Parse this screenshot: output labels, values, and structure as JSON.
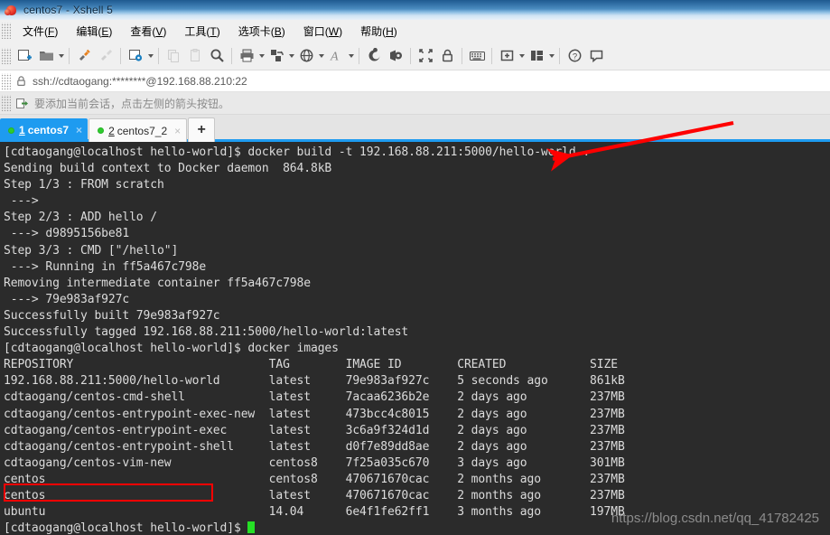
{
  "window": {
    "title": "centos7 - Xshell 5",
    "logo_icon": "xshell-logo-icon"
  },
  "menubar": {
    "items": [
      {
        "name": "file",
        "pre": "文件(",
        "key": "F",
        "post": ")"
      },
      {
        "name": "edit",
        "pre": "编辑(",
        "key": "E",
        "post": ")"
      },
      {
        "name": "view",
        "pre": "查看(",
        "key": "V",
        "post": ")"
      },
      {
        "name": "tools",
        "pre": "工具(",
        "key": "T",
        "post": ")"
      },
      {
        "name": "tabs",
        "pre": "选项卡(",
        "key": "B",
        "post": ")"
      },
      {
        "name": "window",
        "pre": "窗口(",
        "key": "W",
        "post": ")"
      },
      {
        "name": "help",
        "pre": "帮助(",
        "key": "H",
        "post": ")"
      }
    ]
  },
  "toolbar": {
    "buttons": [
      {
        "name": "new-session-icon",
        "enabled": true,
        "caret": false
      },
      {
        "name": "open-folder-icon",
        "enabled": true,
        "caret": true
      },
      {
        "name": "connect-icon",
        "enabled": true,
        "caret": false
      },
      {
        "name": "disconnect-icon",
        "enabled": false,
        "caret": false
      },
      {
        "name": "session-properties-icon",
        "enabled": true,
        "caret": true
      },
      {
        "name": "copy-icon",
        "enabled": false,
        "caret": false
      },
      {
        "name": "paste-icon",
        "enabled": false,
        "caret": false
      },
      {
        "name": "find-icon",
        "enabled": true,
        "caret": false
      },
      {
        "name": "print-icon",
        "enabled": true,
        "caret": true
      },
      {
        "name": "file-transfer-icon",
        "enabled": true,
        "caret": true
      },
      {
        "name": "globe-icon",
        "enabled": true,
        "caret": true
      },
      {
        "name": "font-icon",
        "enabled": true,
        "caret": true
      },
      {
        "name": "compose-icon",
        "enabled": true,
        "caret": false
      },
      {
        "name": "log-icon",
        "enabled": true,
        "caret": false
      },
      {
        "name": "fullscreen-icon",
        "enabled": true,
        "caret": false
      },
      {
        "name": "lock-icon",
        "enabled": true,
        "caret": false
      },
      {
        "name": "keyboard-icon",
        "enabled": true,
        "caret": false
      },
      {
        "name": "add-pane-icon",
        "enabled": true,
        "caret": true
      },
      {
        "name": "arrange-layout-icon",
        "enabled": true,
        "caret": true
      },
      {
        "name": "help-icon",
        "enabled": true,
        "caret": false
      },
      {
        "name": "chat-icon",
        "enabled": true,
        "caret": false
      }
    ]
  },
  "address_bar": {
    "lock_icon": "lock-icon",
    "url": "ssh://cdtaogang:********@192.168.88.210:22"
  },
  "hint_bar": {
    "icon": "add-session-icon",
    "text": "要添加当前会话，点击左侧的箭头按钮。"
  },
  "tabs": {
    "items": [
      {
        "name": "tab-centos7",
        "number": "1",
        "label": "centos7",
        "active": true,
        "status": "connected",
        "close": "×"
      },
      {
        "name": "tab-centos7-2",
        "number": "2",
        "label": "centos7_2",
        "active": false,
        "status": "connected",
        "close": "×"
      }
    ],
    "new_tab_label": "+"
  },
  "terminal": {
    "prompt": "[cdtaogang@localhost hello-world]$ ",
    "lines": [
      "[cdtaogang@localhost hello-world]$ docker build -t 192.168.88.211:5000/hello-world .",
      "Sending build context to Docker daemon  864.8kB",
      "Step 1/3 : FROM scratch",
      " ---> ",
      "Step 2/3 : ADD hello /",
      " ---> d9895156be81",
      "Step 3/3 : CMD [\"/hello\"]",
      " ---> Running in ff5a467c798e",
      "Removing intermediate container ff5a467c798e",
      " ---> 79e983af927c",
      "Successfully built 79e983af927c",
      "Successfully tagged 192.168.88.211:5000/hello-world:latest",
      "[cdtaogang@localhost hello-world]$ docker images",
      "REPOSITORY                            TAG        IMAGE ID        CREATED            SIZE",
      "192.168.88.211:5000/hello-world       latest     79e983af927c    5 seconds ago      861kB",
      "cdtaogang/centos-cmd-shell            latest     7acaa6236b2e    2 days ago         237MB",
      "cdtaogang/centos-entrypoint-exec-new  latest     473bcc4c8015    2 days ago         237MB",
      "cdtaogang/centos-entrypoint-exec      latest     3c6a9f324d1d    2 days ago         237MB",
      "cdtaogang/centos-entrypoint-shell     latest     d0f7e89dd8ae    2 days ago         237MB",
      "cdtaogang/centos-vim-new              centos8    7f25a035c670    3 days ago         301MB",
      "centos                                centos8    470671670cac    2 months ago       237MB",
      "centos                                latest     470671670cac    2 months ago       237MB",
      "ubuntu                                14.04      6e4f1fe62ff1    3 months ago       197MB"
    ],
    "images_table": {
      "columns": [
        "REPOSITORY",
        "TAG",
        "IMAGE ID",
        "CREATED",
        "SIZE"
      ],
      "rows": [
        [
          "192.168.88.211:5000/hello-world",
          "latest",
          "79e983af927c",
          "5 seconds ago",
          "861kB"
        ],
        [
          "cdtaogang/centos-cmd-shell",
          "latest",
          "7acaa6236b2e",
          "2 days ago",
          "237MB"
        ],
        [
          "cdtaogang/centos-entrypoint-exec-new",
          "latest",
          "473bcc4c8015",
          "2 days ago",
          "237MB"
        ],
        [
          "cdtaogang/centos-entrypoint-exec",
          "latest",
          "3c6a9f324d1d",
          "2 days ago",
          "237MB"
        ],
        [
          "cdtaogang/centos-entrypoint-shell",
          "latest",
          "d0f7e89dd8ae",
          "2 days ago",
          "237MB"
        ],
        [
          "cdtaogang/centos-vim-new",
          "centos8",
          "7f25a035c670",
          "3 days ago",
          "301MB"
        ],
        [
          "centos",
          "centos8",
          "470671670cac",
          "2 months ago",
          "237MB"
        ],
        [
          "centos",
          "latest",
          "470671670cac",
          "2 months ago",
          "237MB"
        ],
        [
          "ubuntu",
          "14.04",
          "6e4f1fe62ff1",
          "3 months ago",
          "197MB"
        ]
      ]
    },
    "cursor_color": "#25e025",
    "background": "#2b2b2b",
    "text_color": "#dcdcdc"
  },
  "annotations": {
    "highlight_color": "#ff0000",
    "box_target": "192.168.88.211:5000/hello-world",
    "arrow_target": "docker build -t 192.168.88.211:5000/hello-world ."
  },
  "watermark": {
    "text": "https://blog.csdn.net/qq_41782425"
  }
}
